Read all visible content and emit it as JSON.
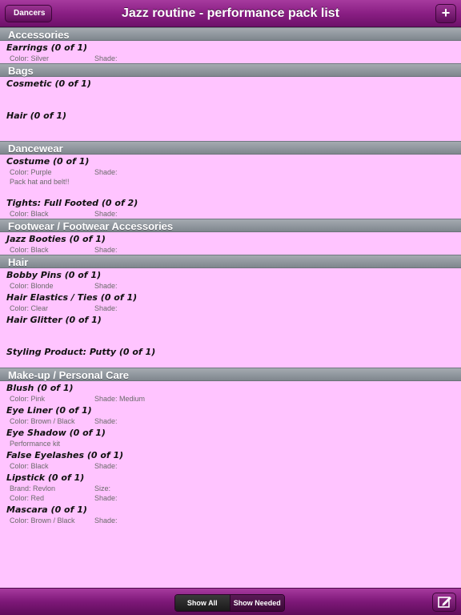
{
  "navbar": {
    "title": "Jazz routine - performance pack list",
    "back_label": "Dancers",
    "add_label": "+"
  },
  "sections": [
    {
      "title": "Accessories",
      "items": [
        {
          "name": "Earrings (0 of 1)",
          "details": [
            [
              "Color: Silver",
              "Shade:"
            ]
          ]
        }
      ]
    },
    {
      "title": "Bags",
      "items": [
        {
          "name": "Cosmetic (0 of 1)",
          "details": [
            [
              "",
              ""
            ],
            [
              "",
              ""
            ]
          ]
        },
        {
          "name": "Hair (0 of 1)",
          "details": [
            [
              "",
              ""
            ],
            [
              "",
              ""
            ]
          ]
        }
      ]
    },
    {
      "title": "Dancewear",
      "items": [
        {
          "name": "Costume (0 of 1)",
          "details": [
            [
              "Color: Purple",
              "Shade:"
            ],
            [
              "Pack hat and belt!!",
              ""
            ],
            [
              "",
              ""
            ]
          ]
        },
        {
          "name": "Tights: Full Footed (0 of 2)",
          "details": [
            [
              "Color: Black",
              "Shade:"
            ]
          ]
        }
      ]
    },
    {
      "title": "Footwear / Footwear Accessories",
      "items": [
        {
          "name": "Jazz Booties (0 of 1)",
          "details": [
            [
              "Color: Black",
              "Shade:"
            ]
          ]
        }
      ]
    },
    {
      "title": "Hair",
      "items": [
        {
          "name": "Bobby Pins (0 of 1)",
          "details": [
            [
              "Color: Blonde",
              "Shade:"
            ]
          ]
        },
        {
          "name": "Hair Elastics / Ties (0 of 1)",
          "details": [
            [
              "Color: Clear",
              "Shade:"
            ]
          ]
        },
        {
          "name": "Hair Glitter (0 of 1)",
          "details": [
            [
              "",
              ""
            ],
            [
              "",
              ""
            ]
          ]
        },
        {
          "name": "Styling Product:  Putty (0 of 1)",
          "details": [
            [
              "",
              ""
            ]
          ]
        }
      ]
    },
    {
      "title": "Make-up / Personal Care",
      "items": [
        {
          "name": "Blush (0 of 1)",
          "details": [
            [
              "Color: Pink",
              "Shade: Medium"
            ]
          ]
        },
        {
          "name": "Eye Liner (0 of 1)",
          "details": [
            [
              "Color: Brown / Black",
              "Shade:"
            ]
          ]
        },
        {
          "name": "Eye Shadow (0 of 1)",
          "details": [
            [
              "Performance kit",
              ""
            ]
          ]
        },
        {
          "name": "False Eyelashes (0 of 1)",
          "details": [
            [
              "Color: Black",
              "Shade:"
            ]
          ]
        },
        {
          "name": "Lipstick (0 of 1)",
          "details": [
            [
              "Brand: Revlon",
              "Size:"
            ],
            [
              "Color: Red",
              "Shade:"
            ]
          ]
        },
        {
          "name": "Mascara (0 of 1)",
          "details": [
            [
              "Color: Brown / Black",
              "Shade:"
            ]
          ]
        }
      ]
    }
  ],
  "toolbar": {
    "show_all": "Show All",
    "show_needed": "Show Needed",
    "compose_icon": "compose-icon"
  },
  "colors": {
    "accent": "#8a1f84",
    "background": "#ffc4ff",
    "section_header": "#8e959c"
  }
}
